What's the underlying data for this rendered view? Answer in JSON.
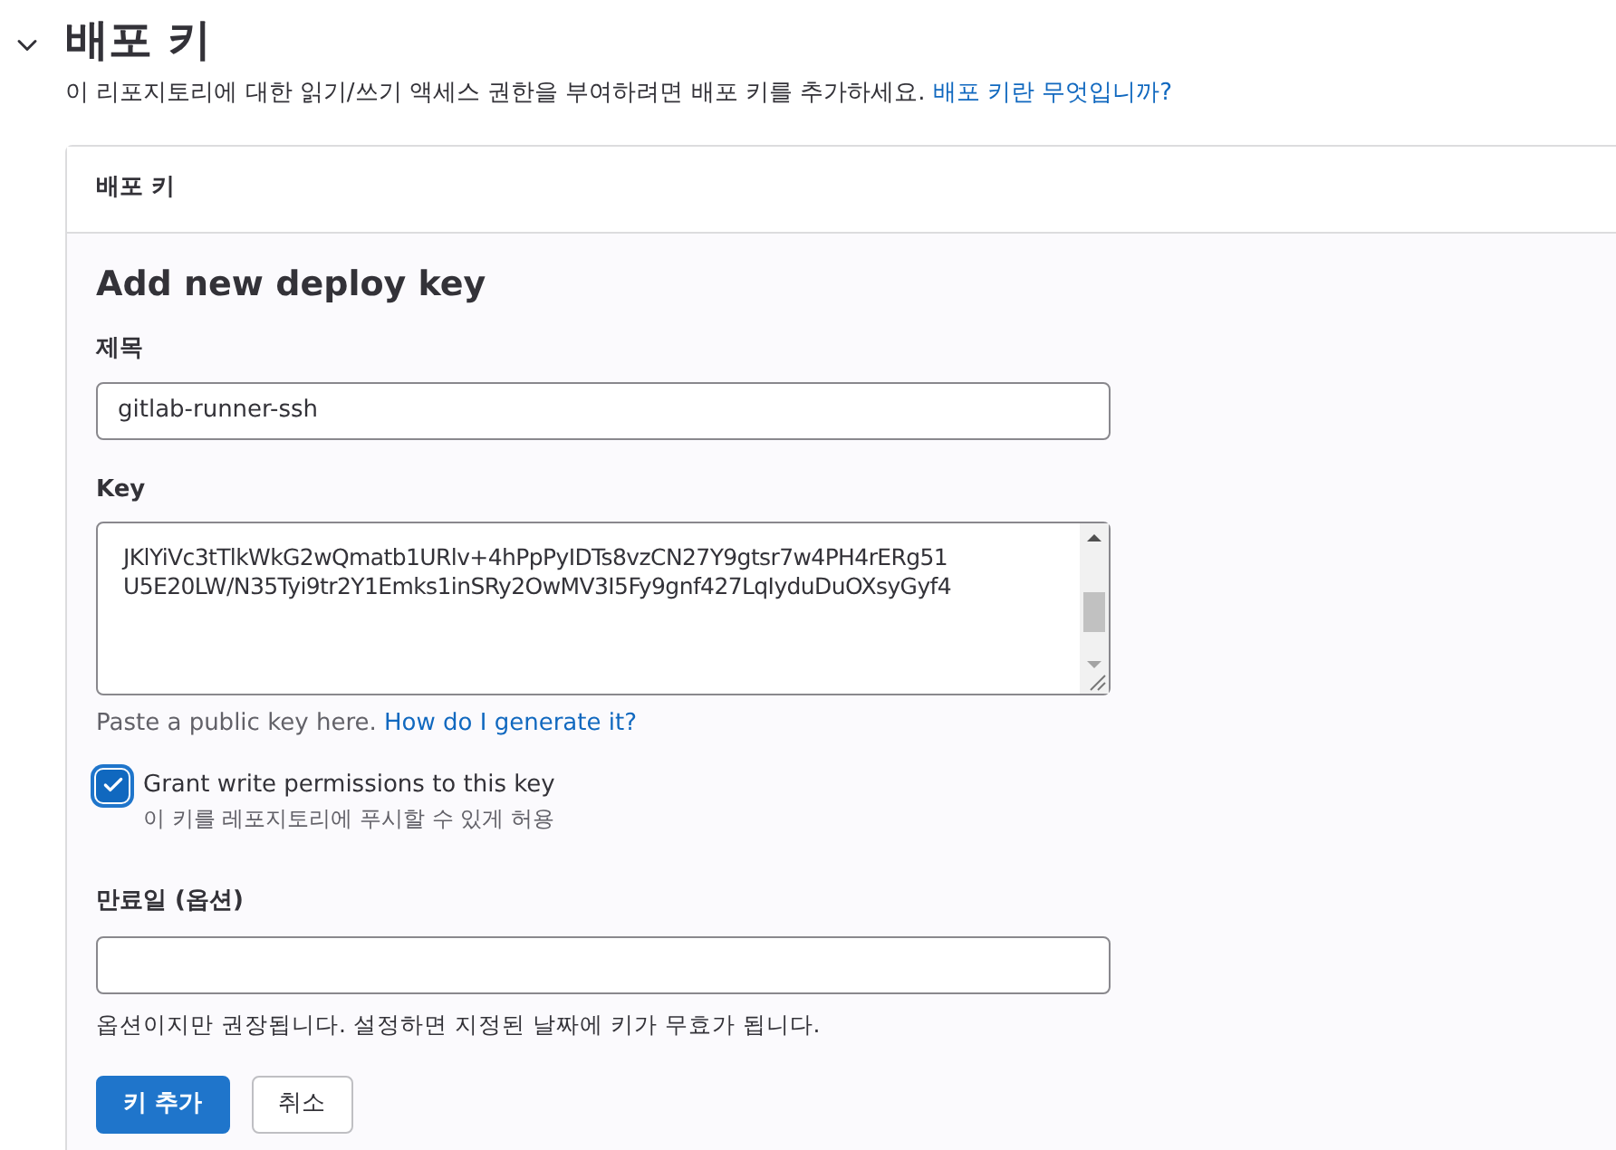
{
  "section": {
    "title": "배포 키",
    "expanded": true,
    "description": "이 리포지토리에 대한 읽기/쓰기 액세스 권한을 부여하려면 배포 키를 추가하세요.",
    "help_link": "배포 키란 무엇입니까?"
  },
  "card": {
    "header": "배포 키",
    "form_title": "Add new deploy key",
    "title_field": {
      "label": "제목",
      "value": "gitlab-runner-ssh"
    },
    "key_field": {
      "label": "Key",
      "value_lines": [
        "JKlYiVc3tTlkWkG2wQmatb1URlv+4hPpPyIDTs8vzCN27Y9gtsr7w4PH4rERg51",
        "U5E20LW/N35Tyi9tr2Y1Emks1inSRy2OwMV3I5Fy9gnf427LqIyduDuOXsyGyf4"
      ],
      "help": "Paste a public key here.",
      "help_link": "How do I generate it?"
    },
    "write_access": {
      "label": "Grant write permissions to this key",
      "hint": "이 키를 레포지토리에 푸시할 수 있게 허용",
      "checked": true
    },
    "expiry_field": {
      "label": "만료일 (옵션)",
      "help": "옵션이지만 권장됩니다. 설정하면 지정된 날짜에 키가 무효가 됩니다."
    },
    "buttons": [
      {
        "kind": "primary",
        "label": "키 추가"
      },
      {
        "kind": "secondary",
        "label": "취소"
      }
    ]
  }
}
